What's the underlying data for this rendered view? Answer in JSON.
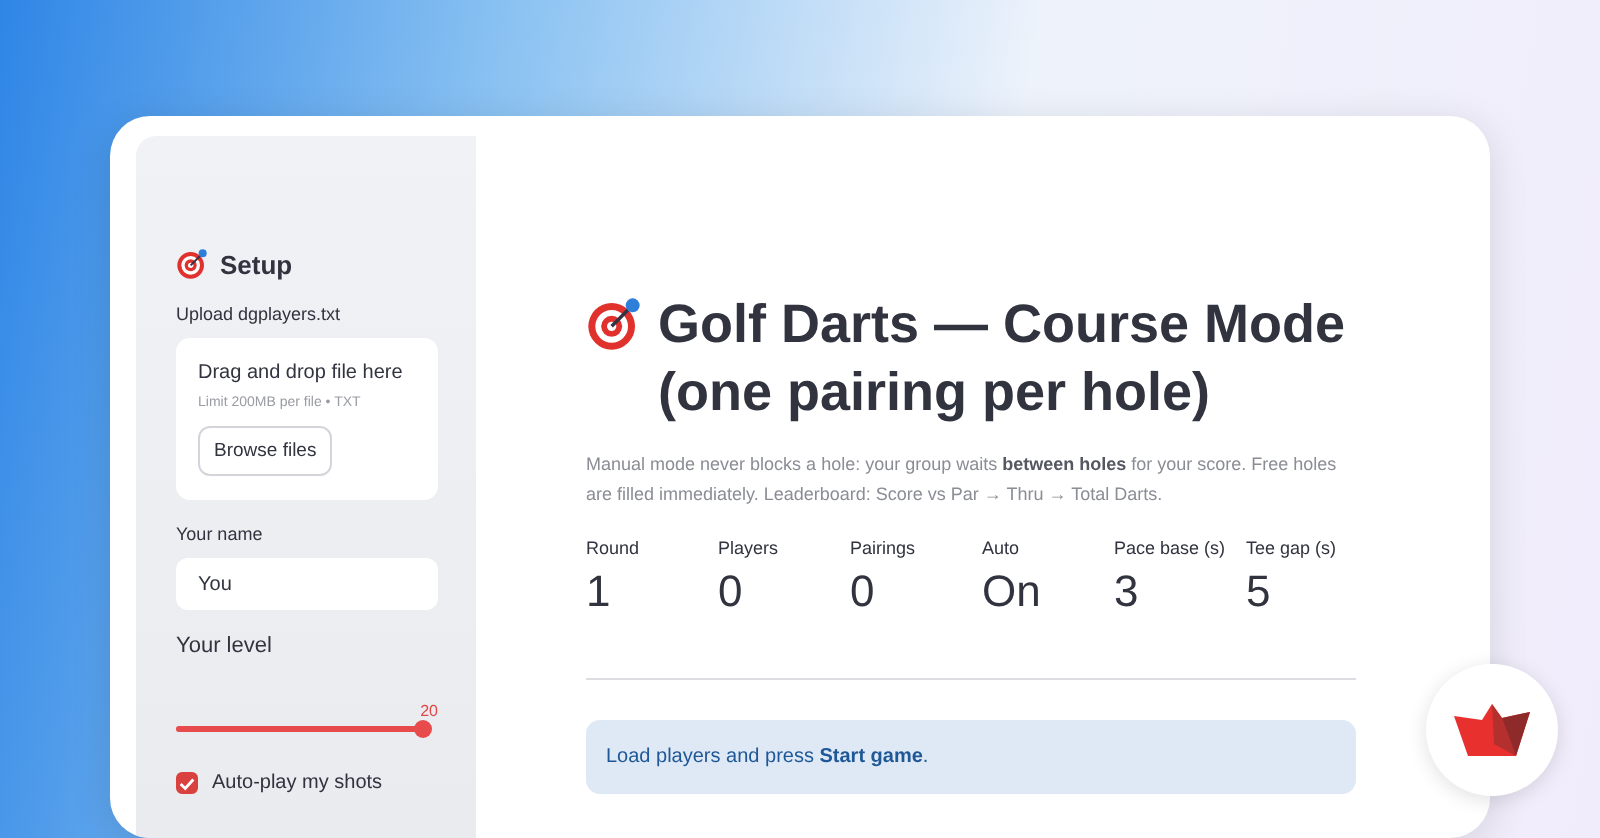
{
  "sidebar": {
    "title": "Setup",
    "uploader": {
      "label": "Upload dgplayers.txt",
      "prompt": "Drag and drop file here",
      "limit": "Limit 200MB per file • TXT",
      "button": "Browse files"
    },
    "name_field": {
      "label": "Your name",
      "value": "You"
    },
    "level_slider": {
      "label": "Your level",
      "reading": "20",
      "level": 1.0
    },
    "auto_play": {
      "label": "Auto-play my shots",
      "checked": true
    }
  },
  "main": {
    "title": "Golf Darts — Course Mode (one pairing per hole)",
    "description": "Manual mode never blocks a hole: your group waits **between holes** for your score. Free holes are filled immediately. Leaderboard: Score vs Par → Thru → Total Darts.",
    "metrics": [
      {
        "label": "Round",
        "value": "1"
      },
      {
        "label": "Players",
        "value": "0"
      },
      {
        "label": "Pairings",
        "value": "0"
      },
      {
        "label": "Auto",
        "value": "On"
      },
      {
        "label": "Pace base (s)",
        "value": "3"
      },
      {
        "label": "Tee gap (s)",
        "value": "5"
      }
    ],
    "info": "Load players and press **Start game**."
  }
}
